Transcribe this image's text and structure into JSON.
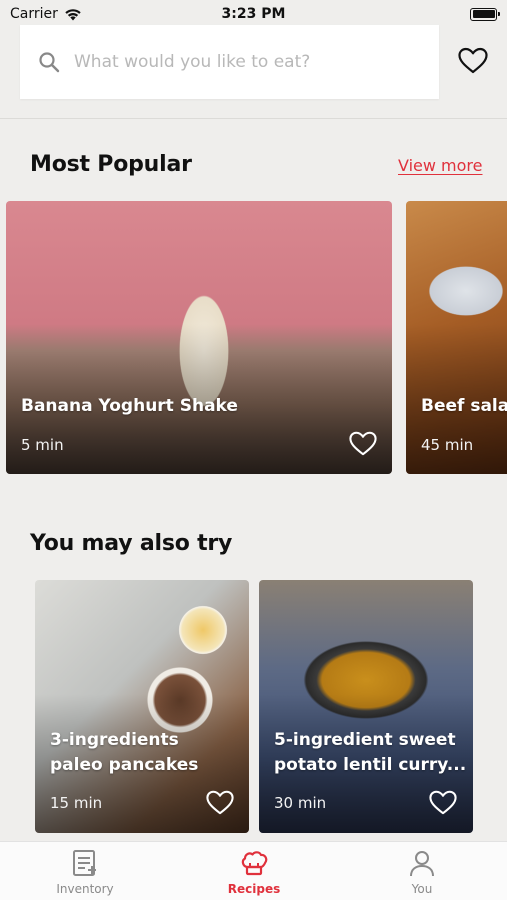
{
  "status_bar": {
    "carrier": "Carrier",
    "time": "3:23 PM",
    "icons": [
      "wifi-icon",
      "battery-icon"
    ]
  },
  "search": {
    "placeholder": "What would you like to eat?",
    "value": "",
    "icon": "search-icon",
    "favorites_icon": "heart-outline-icon"
  },
  "most_popular": {
    "title": "Most Popular",
    "view_more": "View more",
    "cards": [
      {
        "title": "Banana Yoghurt Shake",
        "time": "5 min",
        "icon": "heart-outline-icon"
      },
      {
        "title": "Beef sala",
        "time": "45 min"
      }
    ]
  },
  "also_try": {
    "title": "You may also try",
    "cards": [
      {
        "title_line1": "3-ingredients",
        "title_line2": "paleo pancakes",
        "time": "15 min",
        "icon": "heart-outline-icon"
      },
      {
        "title_line1": "5-ingredient sweet",
        "title_line2": "potato lentil curry...",
        "time": "30 min",
        "icon": "heart-outline-icon"
      }
    ]
  },
  "tabbar": {
    "tabs": [
      {
        "label": "Inventory",
        "icon": "inventory-list-icon",
        "active": false
      },
      {
        "label": "Recipes",
        "icon": "chef-hat-icon",
        "active": true
      },
      {
        "label": "You",
        "icon": "user-icon",
        "active": false
      }
    ]
  },
  "colors": {
    "accent": "#e0313c",
    "background": "#efeeec",
    "tab_inactive": "#8a8a8a"
  }
}
